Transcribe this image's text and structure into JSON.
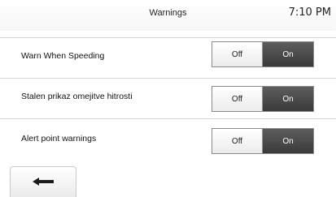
{
  "header": {
    "title": "Warnings",
    "time": "7:10 PM"
  },
  "settings": [
    {
      "label": "Warn When Speeding",
      "off_label": "Off",
      "on_label": "On",
      "selected": "On"
    },
    {
      "label": "Stalen prikaz omejitve hitrosti",
      "off_label": "Off",
      "on_label": "On",
      "selected": "On"
    },
    {
      "label": "Alert point warnings",
      "off_label": "Off",
      "on_label": "On",
      "selected": "On"
    }
  ],
  "footer": {
    "back_icon": "left-arrow-icon"
  },
  "colors": {
    "toggle_active": "#4a4a4a",
    "toggle_inactive": "#f2f2f2",
    "separator": "#d6d6d6"
  }
}
